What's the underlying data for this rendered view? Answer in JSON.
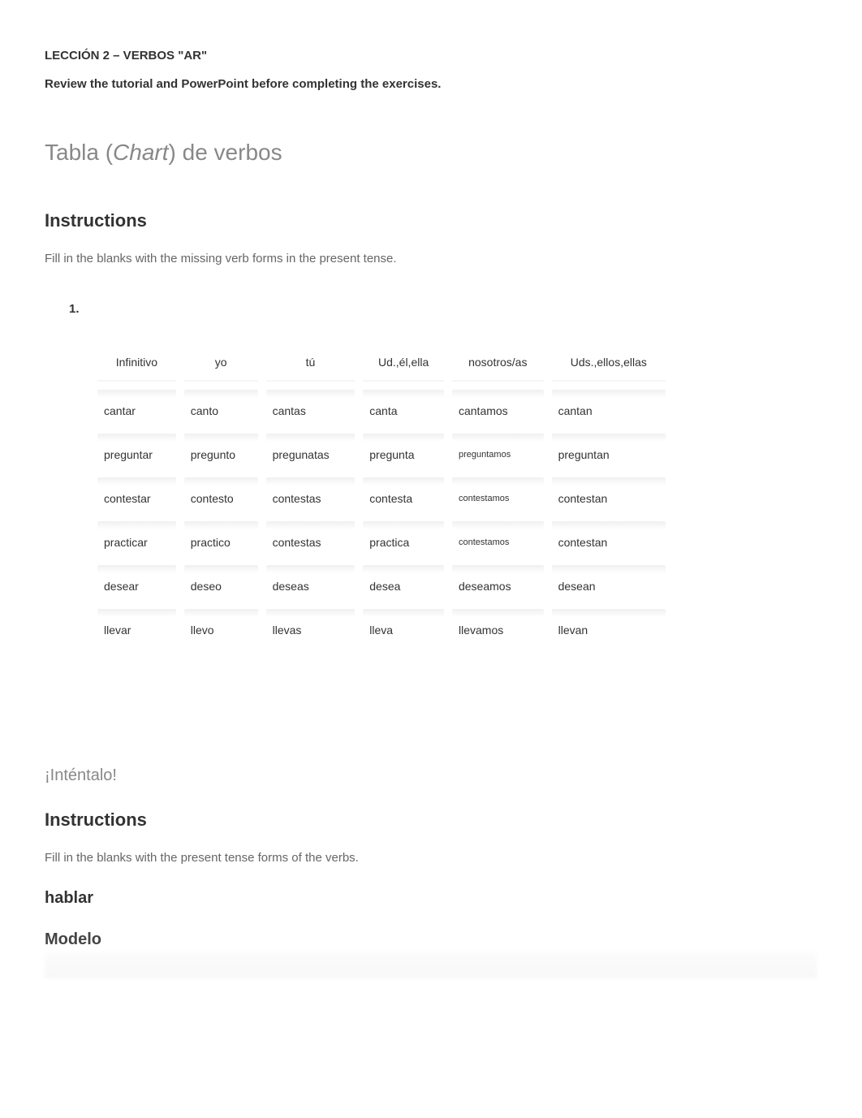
{
  "lesson_title": "LECCIÓN 2 – VERBOS \"AR\"",
  "review_text": "Review the tutorial and PowerPoint before completing the exercises.",
  "section1": {
    "title_prefix": "Tabla (",
    "title_italic": "Chart",
    "title_suffix": ") de verbos",
    "instructions_heading": "Instructions",
    "instructions_text": "Fill in the blanks with the missing verb forms in the present tense.",
    "question_number": "1."
  },
  "chart_data": {
    "type": "table",
    "headers": [
      "Infinitivo",
      "yo",
      "tú",
      "Ud.,él,ella",
      "nosotros/as",
      "Uds.,ellos,ellas"
    ],
    "rows": [
      [
        "cantar",
        "canto",
        "cantas",
        "canta",
        "cantamos",
        "cantan"
      ],
      [
        "preguntar",
        "pregunto",
        "pregunatas",
        "pregunta",
        "preguntamos",
        "preguntan"
      ],
      [
        "contestar",
        "contesto",
        "contestas",
        "contesta",
        "contestamos",
        "contestan"
      ],
      [
        "practicar",
        "practico",
        "contestas",
        "practica",
        "contestamos",
        "contestan"
      ],
      [
        "desear",
        "deseo",
        "deseas",
        "desea",
        "deseamos",
        "desean"
      ],
      [
        "llevar",
        "llevo",
        "llevas",
        "lleva",
        "llevamos",
        "llevan"
      ]
    ],
    "small_cells": [
      {
        "row": 1,
        "col": 4
      },
      {
        "row": 2,
        "col": 4
      },
      {
        "row": 3,
        "col": 4
      }
    ]
  },
  "section2": {
    "try_title": "¡Inténtalo!",
    "instructions_heading": "Instructions",
    "instructions_text": "Fill in the blanks with the present tense forms of the verbs.",
    "verb_heading": "hablar",
    "modelo_heading": "Modelo"
  }
}
